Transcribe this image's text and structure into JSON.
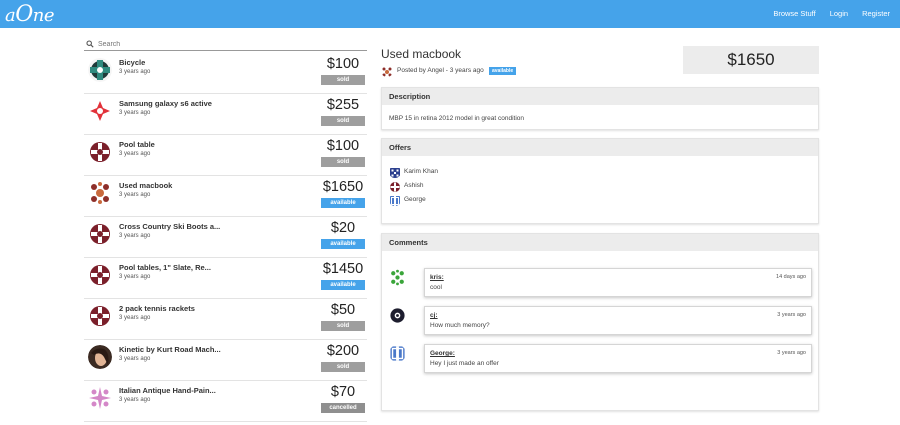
{
  "nav": {
    "brand_a": "a",
    "brand_o": "O",
    "brand_ne": "ne",
    "browse": "Browse Stuff",
    "login": "Login",
    "register": "Register"
  },
  "colors": {
    "accent": "#45a3ea",
    "sold": "#9e9e9e",
    "panel_header": "#ececec"
  },
  "search": {
    "placeholder": "Search",
    "icon": "search-icon"
  },
  "listings": [
    {
      "title": "Bicycle",
      "time": "3 years ago",
      "price": "$100",
      "status": "sold"
    },
    {
      "title": "Samsung galaxy s6 active",
      "time": "3 years ago",
      "price": "$255",
      "status": "sold"
    },
    {
      "title": "Pool table",
      "time": "3 years ago",
      "price": "$100",
      "status": "sold"
    },
    {
      "title": "Used macbook",
      "time": "3 years ago",
      "price": "$1650",
      "status": "available"
    },
    {
      "title": "Cross Country Ski Boots a...",
      "time": "3 years ago",
      "price": "$20",
      "status": "available"
    },
    {
      "title": "Pool tables, 1\" Slate, Re...",
      "time": "3 years ago",
      "price": "$1450",
      "status": "available"
    },
    {
      "title": "2 pack tennis rackets",
      "time": "3 years ago",
      "price": "$50",
      "status": "sold"
    },
    {
      "title": "Kinetic by Kurt Road Mach...",
      "time": "3 years ago",
      "price": "$200",
      "status": "sold"
    },
    {
      "title": "Italian Antique Hand-Pain...",
      "time": "3 years ago",
      "price": "$70",
      "status": "cancelled"
    }
  ],
  "detail": {
    "title": "Used macbook",
    "posted_by": "Posted by Angel - 3 years ago",
    "status": "available",
    "price": "$1650",
    "description_heading": "Description",
    "description": "MBP 15 in retina 2012 model in great condition",
    "offers_heading": "Offers",
    "offers": [
      {
        "name": "Karim Khan"
      },
      {
        "name": "Ashish"
      },
      {
        "name": "George"
      }
    ],
    "comments_heading": "Comments",
    "comments": [
      {
        "user": "kris:",
        "time": "14 days ago",
        "text": "cool"
      },
      {
        "user": "cj:",
        "time": "3 years ago",
        "text": "How much memory?"
      },
      {
        "user": "George:",
        "time": "3 years ago",
        "text": "Hey I just made an offer"
      }
    ]
  }
}
